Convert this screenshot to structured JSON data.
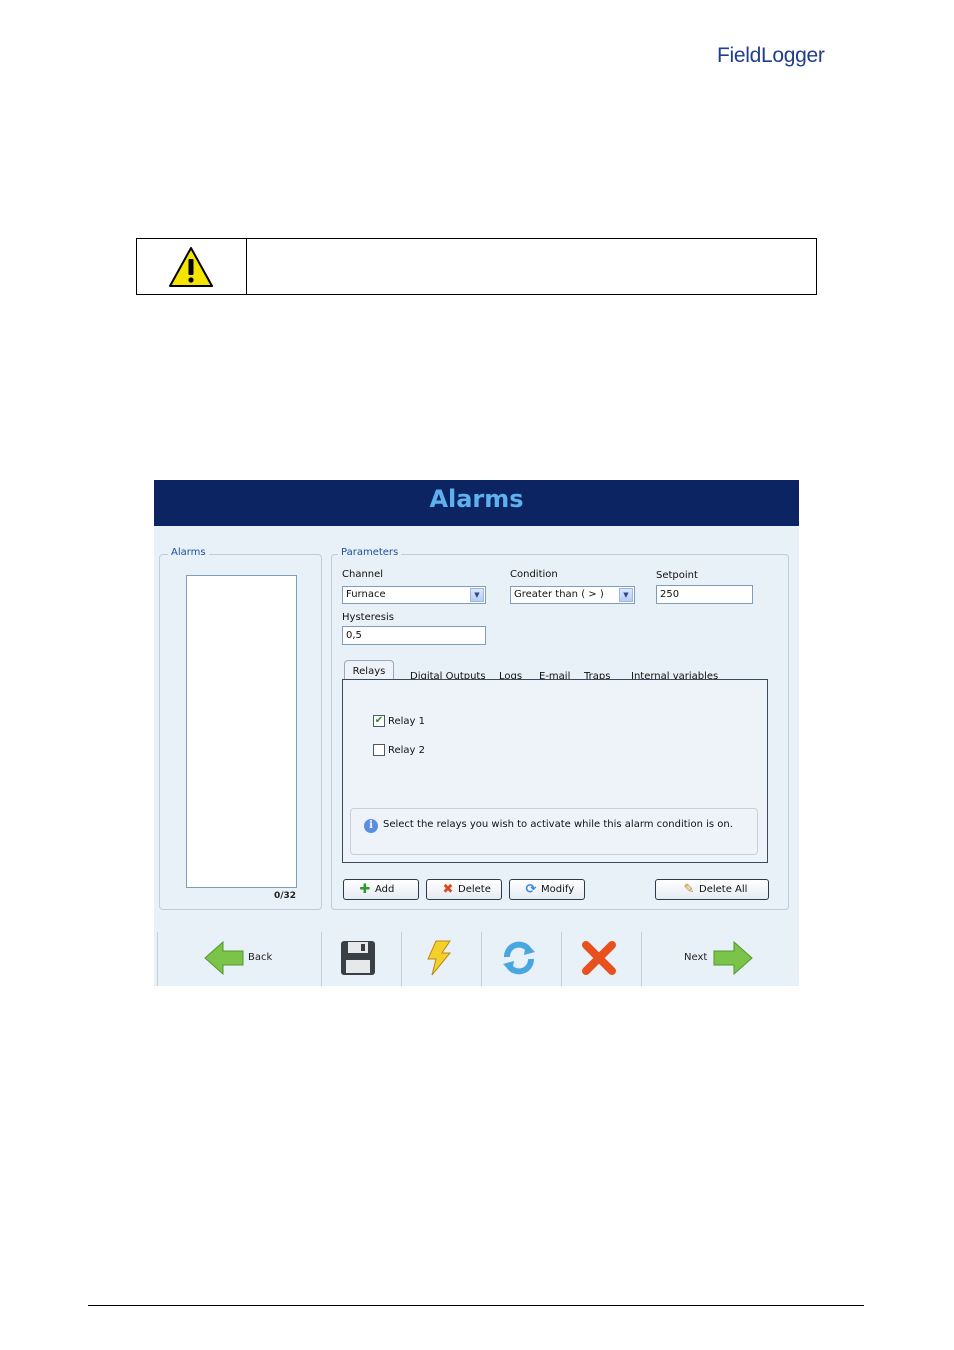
{
  "document": {
    "logo_text": "FieldLogger"
  },
  "app": {
    "title": "Alarms",
    "alarms_group": {
      "label": "Alarms",
      "counter": "0/32"
    },
    "parameters": {
      "label": "Parameters",
      "channel_label": "Channel",
      "channel_value": "Furnace",
      "condition_label": "Condition",
      "condition_value": "Greater than ( > )",
      "setpoint_label": "Setpoint",
      "setpoint_value": "250",
      "hysteresis_label": "Hysteresis",
      "hysteresis_value": "0,5"
    },
    "tabs": [
      {
        "label": "Relays",
        "active": true
      },
      {
        "label": "Digital Outputs"
      },
      {
        "label": "Logs"
      },
      {
        "label": "E-mail"
      },
      {
        "label": "Traps"
      },
      {
        "label": "Internal variables"
      }
    ],
    "relays": [
      {
        "label": "Relay 1",
        "checked": true
      },
      {
        "label": "Relay 2",
        "checked": false
      }
    ],
    "info_text": "Select the relays you wish to activate while this alarm condition is on.",
    "buttons": {
      "add": "Add",
      "delete": "Delete",
      "modify": "Modify",
      "delete_all": "Delete All"
    },
    "toolbar": {
      "back": "Back",
      "next": "Next"
    }
  },
  "colors": {
    "header_bg": "#0c2461",
    "title": "#5fb0ee",
    "panel_bg": "#e8f0f8"
  }
}
